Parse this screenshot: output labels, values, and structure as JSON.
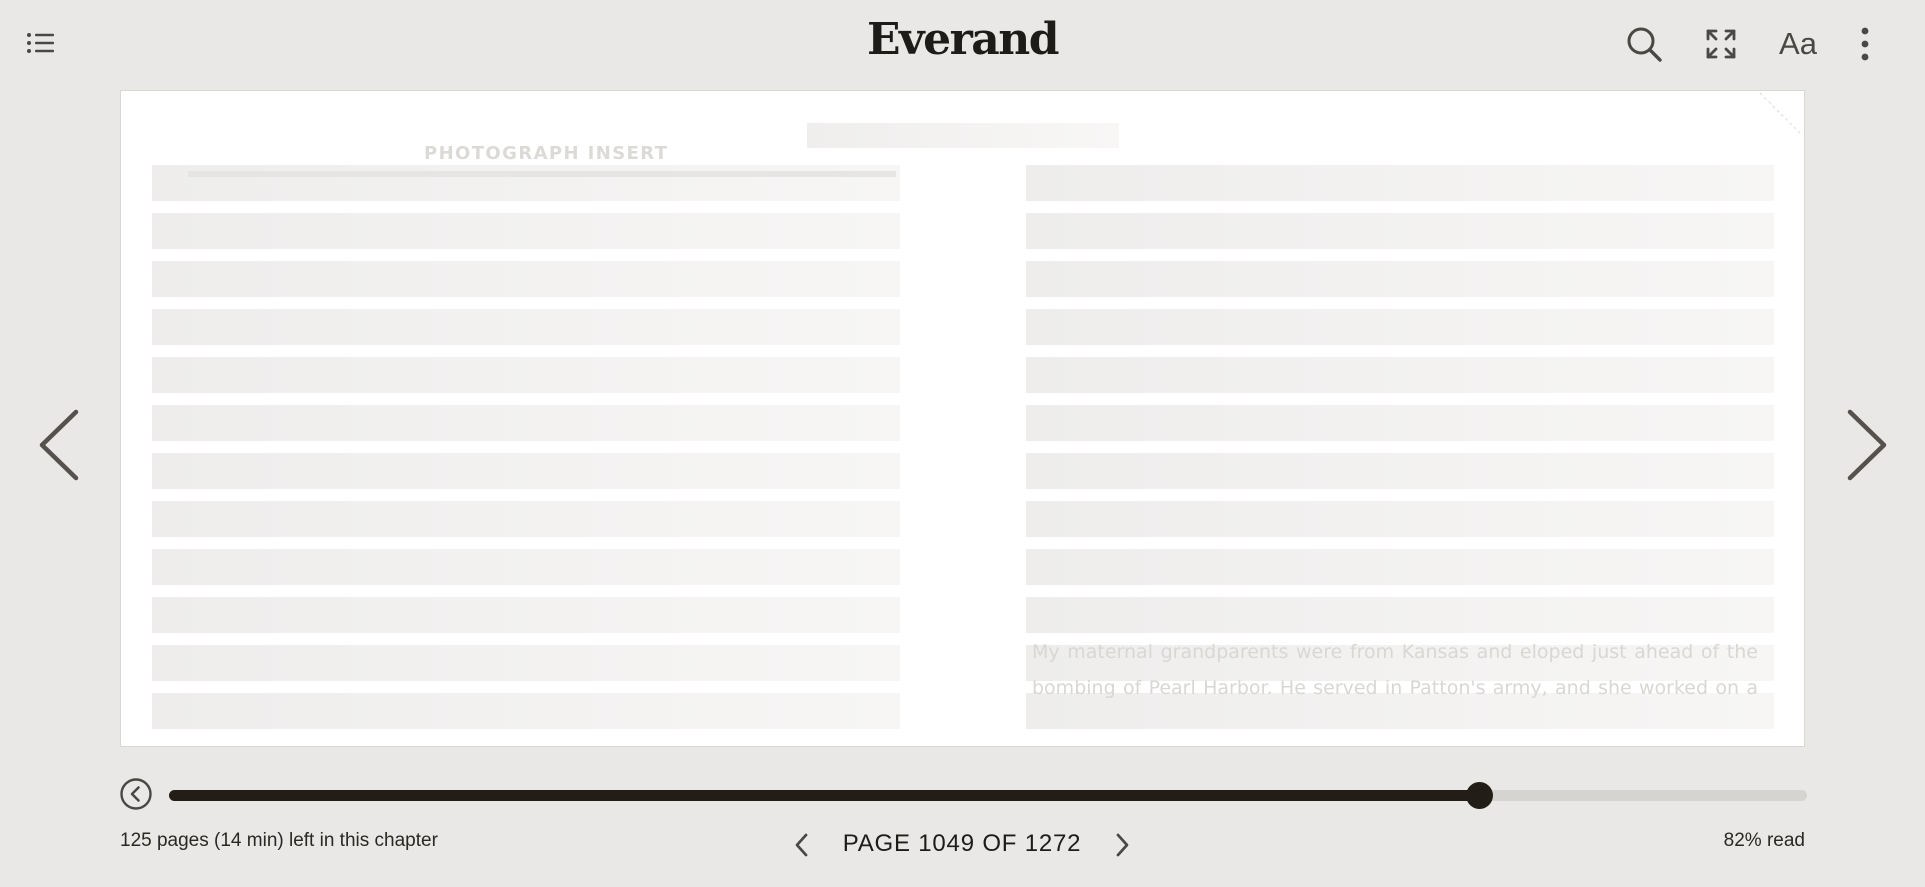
{
  "app": {
    "logo": "Everand"
  },
  "header": {
    "toc_icon": "list-icon",
    "tools": [
      {
        "name": "search-icon"
      },
      {
        "name": "fullscreen-icon"
      },
      {
        "name": "text-settings",
        "label": "Aa"
      },
      {
        "name": "more-vertical-icon"
      }
    ]
  },
  "page": {
    "insert_title": "PHOTOGRAPH INSERT",
    "ghost_text": "My maternal grandparents were from Kansas and eloped just ahead of the bombing of Pearl Harbor. He served in Patton's army, and she worked on a"
  },
  "footer": {
    "chapter_remaining": "125 pages (14 min) left in this chapter",
    "page_indicator": "PAGE 1049 OF 1272",
    "percent_read": "82% read",
    "progress_fraction": 0.8,
    "current_page": 1049,
    "total_pages": 1272
  },
  "colors": {
    "background": "#e9e8e6",
    "accent": "#221e17",
    "track": "#d6d4d1",
    "page": "#ffffff"
  }
}
